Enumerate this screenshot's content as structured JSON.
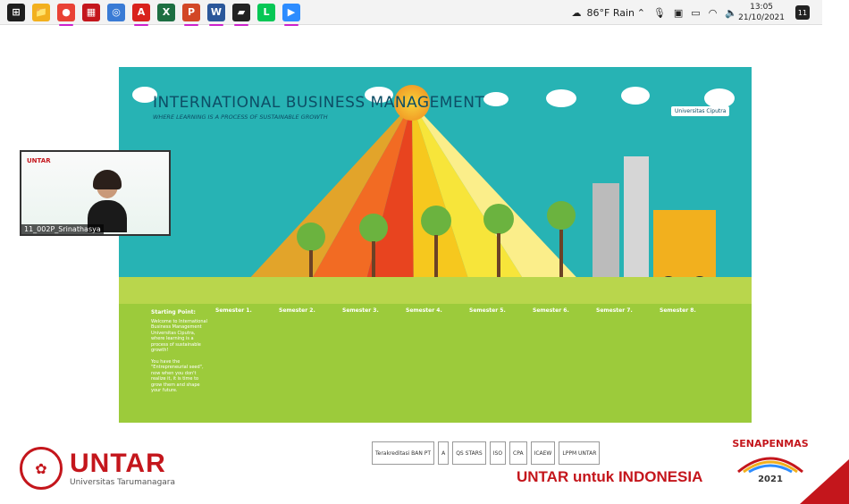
{
  "taskbar": {
    "apps": [
      {
        "name": "windows-start",
        "glyph": "⊞",
        "color": "#1e1e1e",
        "active": false
      },
      {
        "name": "file-explorer",
        "glyph": "📁",
        "color": "#f2b01e",
        "active": false
      },
      {
        "name": "chrome",
        "glyph": "●",
        "color": "#e94235",
        "active": true
      },
      {
        "name": "app-red",
        "glyph": "▦",
        "color": "#c4161c",
        "active": false
      },
      {
        "name": "browser-globe",
        "glyph": "◎",
        "color": "#3a7bd5",
        "active": false
      },
      {
        "name": "acrobat",
        "glyph": "A",
        "color": "#d9221c",
        "active": true
      },
      {
        "name": "excel",
        "glyph": "X",
        "color": "#1d6f42",
        "active": false
      },
      {
        "name": "powerpoint",
        "glyph": "P",
        "color": "#d24726",
        "active": true
      },
      {
        "name": "word",
        "glyph": "W",
        "color": "#2b579a",
        "active": true
      },
      {
        "name": "sticky-notes",
        "glyph": "▰",
        "color": "#222",
        "active": true
      },
      {
        "name": "line",
        "glyph": "L",
        "color": "#06c755",
        "active": false
      },
      {
        "name": "zoom",
        "glyph": "▶",
        "color": "#2d8cff",
        "active": true
      }
    ],
    "weather": "86°F  Rain",
    "time": "13:05",
    "date": "21/10/2021",
    "notifications": "11"
  },
  "slide": {
    "title": "INTERNATIONAL BUSINESS MANAGEMENT",
    "subtitle": "WHERE LEARNING IS A PROCESS OF SUSTAINABLE GROWTH",
    "logo": "Universitas Ciputra",
    "start": {
      "heading": "Starting Point:",
      "line1": "Welcome to International Business Management Universitas Ciputra, where learning is a process of sustainable growth!",
      "line2": "You have the \"Entrepreneurial seed\", now when you don't realize it, it is time to grow them and shape your future."
    },
    "semesters": [
      "Semester 1.",
      "Semester 2.",
      "Semester 3.",
      "Semester 4.",
      "Semester 5.",
      "Semester 6.",
      "Semester 7.",
      "Semester 8."
    ]
  },
  "webcam": {
    "label": "11_002P_Srinathasya"
  },
  "footer": {
    "brand": "UNTAR",
    "brand_sub": "Universitas Tarumanagara",
    "tagline": "UNTAR untuk INDONESIA",
    "event": "SENAPENMAS",
    "event_year": "2021",
    "partners": [
      "Terakreditasi BAN PT",
      "A",
      "QS STARS",
      "ISO",
      "CPA",
      "ICAEW",
      "LPPM UNTAR"
    ]
  }
}
